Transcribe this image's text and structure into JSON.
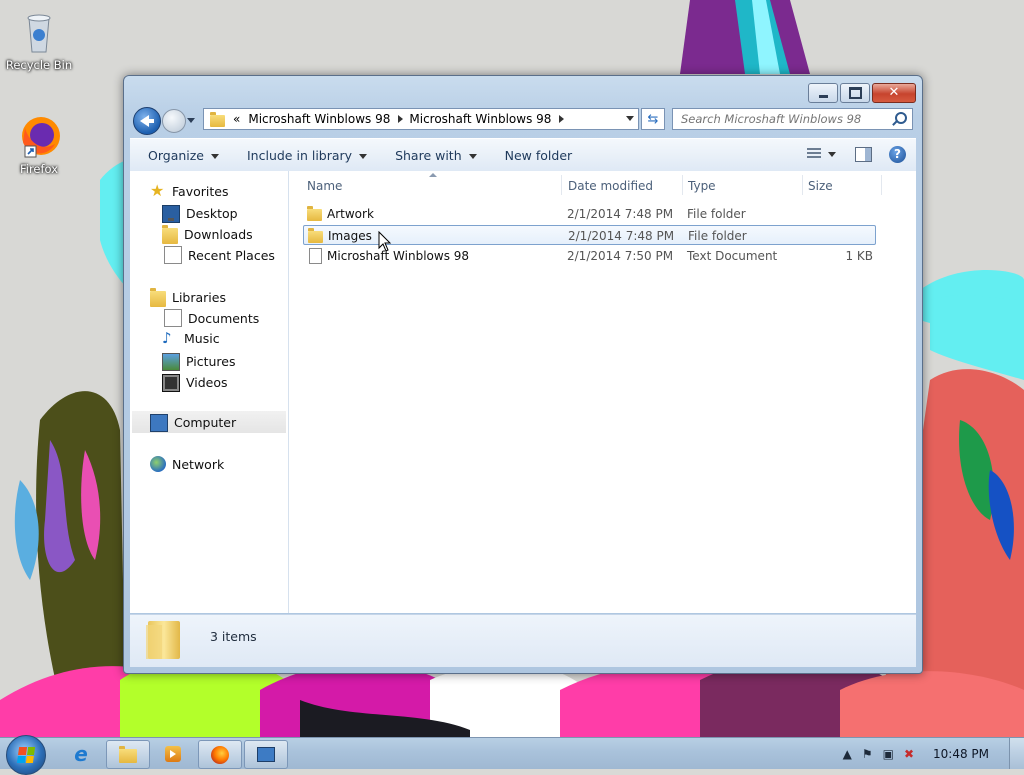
{
  "desktop": {
    "icons": [
      {
        "label": "Recycle Bin",
        "icon": "recycle-bin-icon"
      },
      {
        "label": "Firefox",
        "icon": "firefox-icon"
      }
    ]
  },
  "window": {
    "address": {
      "overflow": "«",
      "crumbs": [
        "Microshaft Winblows 98",
        "Microshaft Winblows 98"
      ]
    },
    "search": {
      "placeholder": "Search Microshaft Winblows 98"
    },
    "commands": {
      "organize": "Organize",
      "include": "Include in library",
      "share": "Share with",
      "new_folder": "New folder"
    },
    "nav": {
      "favorites": "Favorites",
      "desktop": "Desktop",
      "downloads": "Downloads",
      "recent": "Recent Places",
      "libraries": "Libraries",
      "documents": "Documents",
      "music": "Music",
      "pictures": "Pictures",
      "videos": "Videos",
      "computer": "Computer",
      "network": "Network"
    },
    "columns": {
      "name": "Name",
      "date": "Date modified",
      "type": "Type",
      "size": "Size"
    },
    "files": [
      {
        "name": "Artwork",
        "date": "2/1/2014 7:48 PM",
        "type": "File folder",
        "size": "",
        "icon": "folder-icon"
      },
      {
        "name": "Images",
        "date": "2/1/2014 7:48 PM",
        "type": "File folder",
        "size": "",
        "icon": "folder-icon"
      },
      {
        "name": "Microshaft Winblows 98",
        "date": "2/1/2014 7:50 PM",
        "type": "Text Document",
        "size": "1 KB",
        "icon": "text-document-icon"
      }
    ],
    "status": {
      "count": "3 items"
    }
  },
  "taskbar": {
    "clock": "10:48 PM",
    "pinned": [
      "internet-explorer-icon",
      "explorer-folder-icon",
      "media-player-icon",
      "firefox-icon",
      "remote-desktop-icon"
    ]
  },
  "colors": {
    "accent": "#1c5fb0",
    "selection": "#7da2ce",
    "close": "#c7442e"
  }
}
